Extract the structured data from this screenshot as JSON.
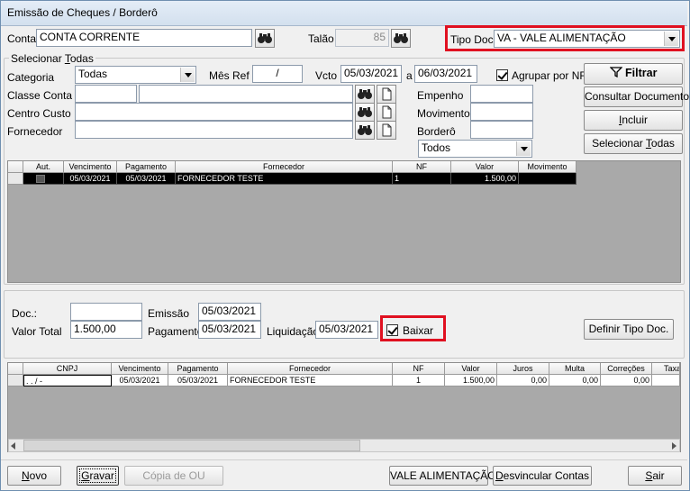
{
  "window": {
    "title": "Emissão de Cheques / Borderô"
  },
  "header": {
    "conta_label": "Conta",
    "conta_value": "CONTA CORRENTE",
    "talao_label": "Talão",
    "talao_value": "85",
    "tipodoc_label": "Tipo Doc",
    "tipodoc_value": "VA - VALE ALIMENTAÇÃO"
  },
  "filter": {
    "legend": "Selecionar Todas",
    "categoria_label": "Categoria",
    "categoria_value": "Todas",
    "mesref_label": "Mês Ref",
    "mesref_value": "/",
    "vcto_label": "Vcto",
    "vcto_from": "05/03/2021",
    "a_label": "a",
    "vcto_to": "06/03/2021",
    "agrupar_label": "Agrupar por NF",
    "classe_label": "Classe Conta",
    "centro_label": "Centro Custo",
    "fornecedor_label": "Fornecedor",
    "empenho_label": "Empenho",
    "movimento_label": "Movimento",
    "bordero_label": "Borderô",
    "status_value": "Todos"
  },
  "actions": {
    "filtrar": "Filtrar",
    "consultar": "Consultar Documento",
    "incluir": "Incluir",
    "selecionar": "Selecionar Todas"
  },
  "top_grid": {
    "headers": [
      "Aut.",
      "Vencimento",
      "Pagamento",
      "Fornecedor",
      "NF",
      "Valor",
      "Movimento"
    ],
    "rows": [
      {
        "vencimento": "05/03/2021",
        "pagamento": "05/03/2021",
        "fornecedor": "FORNECEDOR TESTE",
        "nf": "1",
        "valor": "1.500,00",
        "movimento": ""
      }
    ]
  },
  "doc": {
    "doc_label": "Doc.:",
    "doc_value": "",
    "emissao_label": "Emissão",
    "emissao_value": "05/03/2021",
    "valor_label": "Valor Total",
    "valor_value": "1.500,00",
    "pagamento_label": "Pagamento",
    "pagamento_value": "05/03/2021",
    "liquidacao_label": "Liquidação",
    "liquidacao_value": "05/03/2021",
    "baixar_label": "Baixar",
    "definir_label": "Definir Tipo Doc."
  },
  "bottom_grid": {
    "headers": [
      "CNPJ",
      "Vencimento",
      "Pagamento",
      "Fornecedor",
      "NF",
      "Valor",
      "Juros",
      "Multa",
      "Correções",
      "Taxa"
    ],
    "rows": [
      {
        "cnpj": ". .  /  -",
        "vencimento": "05/03/2021",
        "pagamento": "05/03/2021",
        "fornecedor": "FORNECEDOR TESTE",
        "nf": "1",
        "valor": "1.500,00",
        "juros": "0,00",
        "multa": "0,00",
        "correcoes": "0,00",
        "taxa": ""
      }
    ]
  },
  "footer": {
    "novo": "Novo",
    "gravar": "Gravar",
    "copia": "Cópia de OU",
    "vale": "VALE ALIMENTAÇÃO",
    "desvincular": "Desvincular Contas",
    "sair": "Sair"
  }
}
